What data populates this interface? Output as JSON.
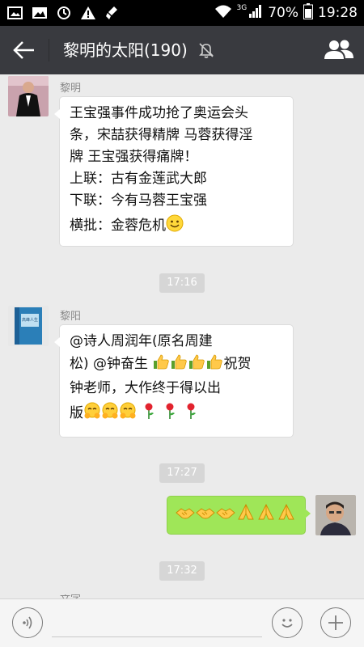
{
  "status_bar": {
    "network": "3G",
    "battery": "70%",
    "time": "19:28"
  },
  "header": {
    "title": "黎明的太阳(190)"
  },
  "messages": [
    {
      "sender": "黎明",
      "lines": [
        "王宝强事件成功抢了奥运会头",
        "条，宋喆获得精牌 马蓉获得淫",
        "牌 王宝强获得痛牌！",
        "上联：古有金莲武大郎",
        "下联：今有马蓉王宝强",
        "横批：金蓉危机"
      ]
    },
    {
      "sender": "黎阳",
      "avatar_book_title": "高峰人生",
      "lines": [
        "@诗人周润年(原名周建",
        "松) @钟奋生",
        "祝贺",
        "钟老师，大作终于得以出",
        "版"
      ]
    }
  ],
  "timestamps": [
    "17:16",
    "17:27",
    "17:32"
  ],
  "bottom_sender_partial": "文字"
}
